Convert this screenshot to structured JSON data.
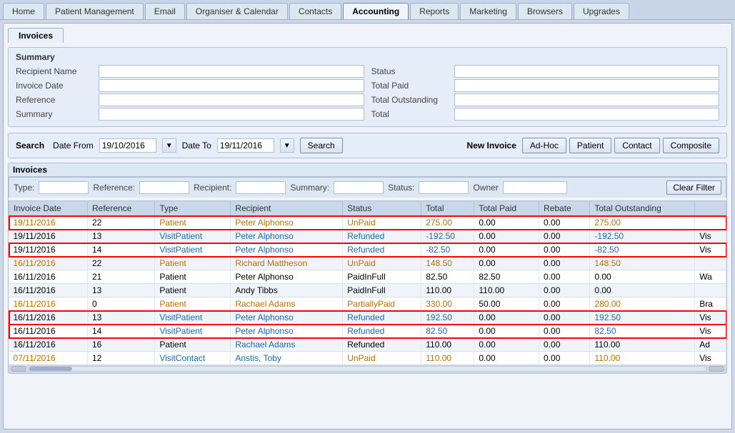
{
  "topTabs": [
    {
      "label": "Home",
      "active": false
    },
    {
      "label": "Patient Management",
      "active": false
    },
    {
      "label": "Email",
      "active": false
    },
    {
      "label": "Organiser & Calendar",
      "active": false
    },
    {
      "label": "Contacts",
      "active": false
    },
    {
      "label": "Accounting",
      "active": true
    },
    {
      "label": "Reports",
      "active": false
    },
    {
      "label": "Marketing",
      "active": false
    },
    {
      "label": "Browsers",
      "active": false
    },
    {
      "label": "Upgrades",
      "active": false
    }
  ],
  "innerTab": "Invoices",
  "summary": {
    "title": "Summary",
    "recipientNameLabel": "Recipient Name",
    "invoiceDateLabel": "Invoice Date",
    "referenceLabel": "Reference",
    "summaryLabel": "Summary",
    "statusLabel": "Status",
    "totalPaidLabel": "Total Paid",
    "totalOutstandingLabel": "Total Outstanding",
    "totalLabel": "Total"
  },
  "search": {
    "sectionTitle": "Search",
    "dateFromLabel": "Date From",
    "dateFromValue": "19/10/2016",
    "dateToLabel": "Date To",
    "dateToValue": "19/11/2016",
    "searchButtonLabel": "Search",
    "newInvoiceLabel": "New Invoice",
    "adHocLabel": "Ad-Hoc",
    "patientLabel": "Patient",
    "contactLabel": "Contact",
    "compositeLabel": "Composite"
  },
  "filter": {
    "typeLabel": "Type:",
    "referenceLabel": "Reference:",
    "recipientLabel": "Recipient:",
    "summaryLabel": "Summary:",
    "statusLabel": "Status:",
    "ownerLabel": "Owner",
    "clearFilterLabel": "Clear Filter"
  },
  "invoicesTable": {
    "title": "Invoices",
    "columns": [
      "Invoice Date",
      "Reference",
      "Type",
      "Recipient",
      "Status",
      "Total",
      "Total Paid",
      "Rebate",
      "Total Outstanding",
      ""
    ],
    "rows": [
      {
        "date": "19/11/2016",
        "ref": "22",
        "type": "Patient",
        "recipient": "Peter Alphonso",
        "status": "UnPaid",
        "total": "275.00",
        "totalPaid": "0.00",
        "rebate": "0.00",
        "outstanding": "275.00",
        "extra": "",
        "redBorder": true,
        "dateColor": "orange",
        "typeColor": "orange",
        "recipientColor": "orange",
        "statusColor": "orange",
        "totalColor": "orange",
        "outstandingColor": "orange"
      },
      {
        "date": "19/11/2016",
        "ref": "13",
        "type": "VisitPatient",
        "recipient": "Peter Alphonso",
        "status": "Refunded",
        "total": "-192.50",
        "totalPaid": "0.00",
        "rebate": "0.00",
        "outstanding": "-192.50",
        "extra": "Vis",
        "redBorder": false,
        "dateColor": "",
        "typeColor": "blue",
        "recipientColor": "blue",
        "statusColor": "blue",
        "totalColor": "blue",
        "outstandingColor": "blue"
      },
      {
        "date": "19/11/2016",
        "ref": "14",
        "type": "VisitPatient",
        "recipient": "Peter Alphonso",
        "status": "Refunded",
        "total": "-82.50",
        "totalPaid": "0.00",
        "rebate": "0.00",
        "outstanding": "-82.50",
        "extra": "Vis",
        "redBorder": true,
        "dateColor": "",
        "typeColor": "blue",
        "recipientColor": "blue",
        "statusColor": "blue",
        "totalColor": "blue",
        "outstandingColor": "blue"
      },
      {
        "date": "16/11/2016",
        "ref": "22",
        "type": "Patient",
        "recipient": "Richard Mattheson",
        "status": "UnPaid",
        "total": "148.50",
        "totalPaid": "0.00",
        "rebate": "0.00",
        "outstanding": "148.50",
        "extra": "",
        "redBorder": false,
        "dateColor": "orange",
        "typeColor": "orange",
        "recipientColor": "orange",
        "statusColor": "orange",
        "totalColor": "orange",
        "outstandingColor": "orange"
      },
      {
        "date": "16/11/2016",
        "ref": "21",
        "type": "Patient",
        "recipient": "Peter Alphonso",
        "status": "PaidInFull",
        "total": "82.50",
        "totalPaid": "82.50",
        "rebate": "0.00",
        "outstanding": "0.00",
        "extra": "Wa",
        "redBorder": false,
        "dateColor": "",
        "typeColor": "",
        "recipientColor": "",
        "statusColor": "",
        "totalColor": "",
        "outstandingColor": ""
      },
      {
        "date": "16/11/2016",
        "ref": "13",
        "type": "Patient",
        "recipient": "Andy Tibbs",
        "status": "PaidInFull",
        "total": "110.00",
        "totalPaid": "110.00",
        "rebate": "0.00",
        "outstanding": "0.00",
        "extra": "",
        "redBorder": false,
        "dateColor": "",
        "typeColor": "",
        "recipientColor": "",
        "statusColor": "",
        "totalColor": "",
        "outstandingColor": ""
      },
      {
        "date": "16/11/2016",
        "ref": "0",
        "type": "Patient",
        "recipient": "Rachael Adams",
        "status": "PartiallyPaid",
        "total": "330.00",
        "totalPaid": "50.00",
        "rebate": "0.00",
        "outstanding": "280.00",
        "extra": "Bra",
        "redBorder": false,
        "dateColor": "orange",
        "typeColor": "orange",
        "recipientColor": "orange",
        "statusColor": "orange",
        "totalColor": "orange",
        "outstandingColor": "orange"
      },
      {
        "date": "16/11/2016",
        "ref": "13",
        "type": "VisitPatient",
        "recipient": "Peter Alphonso",
        "status": "Refunded",
        "total": "192.50",
        "totalPaid": "0.00",
        "rebate": "0.00",
        "outstanding": "192.50",
        "extra": "Vis",
        "redBorder": true,
        "dateColor": "",
        "typeColor": "blue",
        "recipientColor": "blue",
        "statusColor": "blue",
        "totalColor": "blue",
        "outstandingColor": "blue"
      },
      {
        "date": "16/11/2016",
        "ref": "14",
        "type": "VisitPatient",
        "recipient": "Peter Alphonso",
        "status": "Refunded",
        "total": "82.50",
        "totalPaid": "0.00",
        "rebate": "0.00",
        "outstanding": "82.50",
        "extra": "Vis",
        "redBorder": true,
        "dateColor": "",
        "typeColor": "blue",
        "recipientColor": "blue",
        "statusColor": "blue",
        "totalColor": "blue",
        "outstandingColor": "blue"
      },
      {
        "date": "16/11/2016",
        "ref": "16",
        "type": "Patient",
        "recipient": "Rachael Adams",
        "status": "Refunded",
        "total": "110.00",
        "totalPaid": "0.00",
        "rebate": "0.00",
        "outstanding": "110.00",
        "extra": "Ad",
        "redBorder": false,
        "dateColor": "",
        "typeColor": "",
        "recipientColor": "blue",
        "statusColor": "",
        "totalColor": "",
        "outstandingColor": ""
      },
      {
        "date": "07/11/2016",
        "ref": "12",
        "type": "VisitContact",
        "recipient": "Anstis, Toby",
        "status": "UnPaid",
        "total": "110.00",
        "totalPaid": "0.00",
        "rebate": "0.00",
        "outstanding": "110.00",
        "extra": "Vis",
        "redBorder": false,
        "dateColor": "orange",
        "typeColor": "blue",
        "recipientColor": "blue",
        "statusColor": "orange",
        "totalColor": "orange",
        "outstandingColor": "orange"
      }
    ]
  }
}
